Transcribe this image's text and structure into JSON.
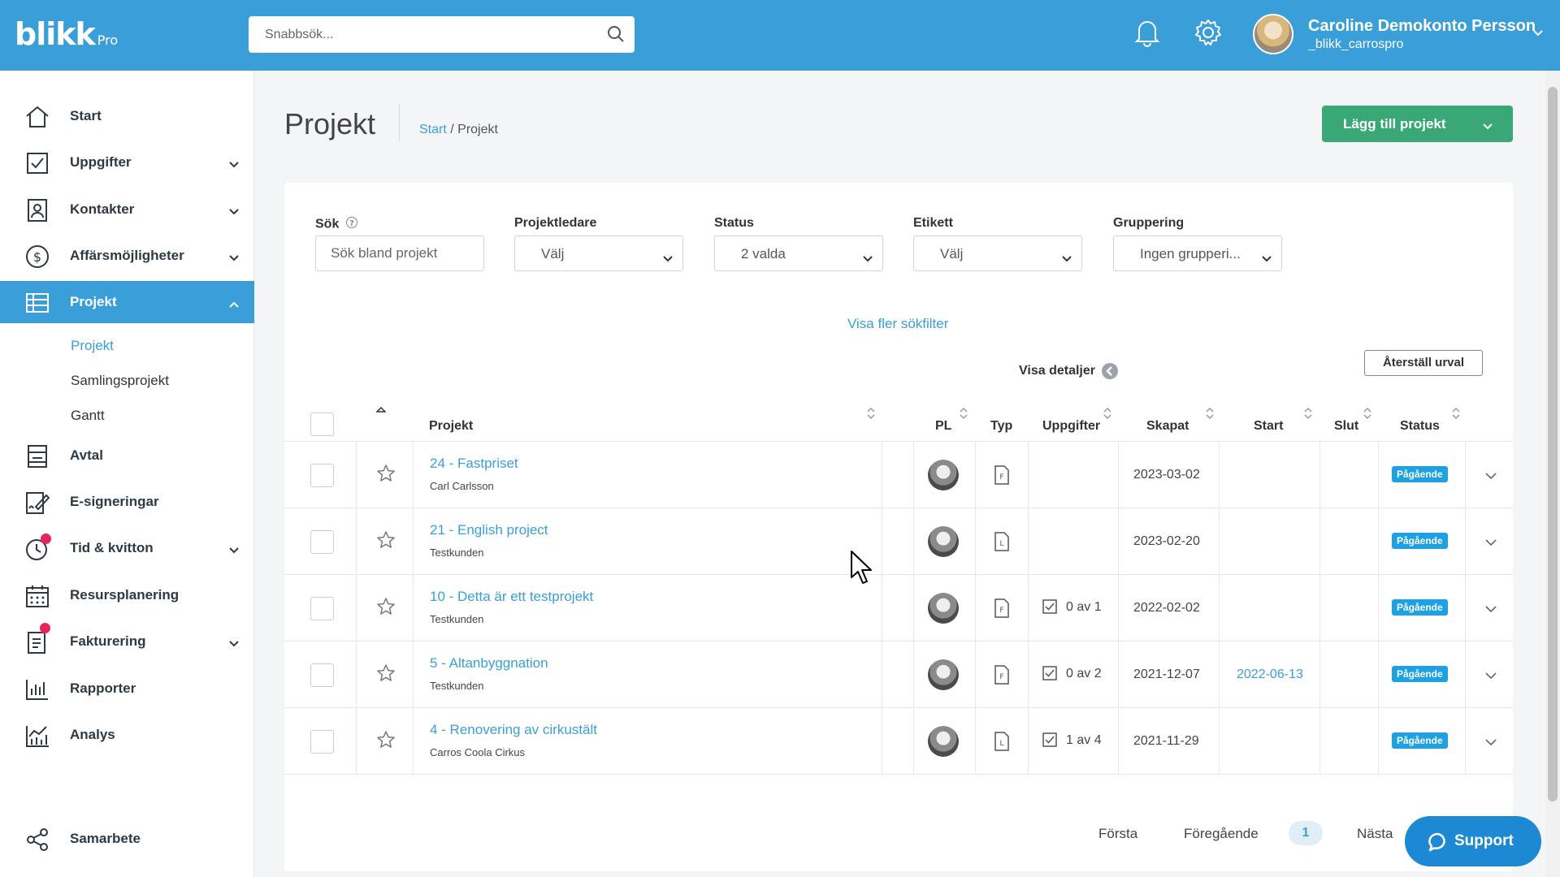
{
  "app": {
    "logo": "blikk",
    "logo_suffix": "Pro"
  },
  "header": {
    "search_placeholder": "Snabbsök...",
    "user_name": "Caroline Demokonto Persson",
    "user_handle": "_blikk_carrospro"
  },
  "sidebar": {
    "items": [
      {
        "label": "Start",
        "icon": "home-icon"
      },
      {
        "label": "Uppgifter",
        "icon": "checkbox-icon"
      },
      {
        "label": "Kontakter",
        "icon": "contact-card-icon"
      },
      {
        "label": "Affärsmöjligheter",
        "icon": "dollar-icon"
      },
      {
        "label": "Projekt",
        "icon": "table-icon"
      },
      {
        "label": "Avtal",
        "icon": "document-icon"
      },
      {
        "label": "E-signeringar",
        "icon": "sign-icon"
      },
      {
        "label": "Tid & kvitton",
        "icon": "clock-icon"
      },
      {
        "label": "Resursplanering",
        "icon": "calendar-icon"
      },
      {
        "label": "Fakturering",
        "icon": "invoice-icon"
      },
      {
        "label": "Rapporter",
        "icon": "bar-chart-icon"
      },
      {
        "label": "Analys",
        "icon": "analytics-icon"
      },
      {
        "label": "Samarbete",
        "icon": "share-icon"
      }
    ],
    "sub_items": [
      "Projekt",
      "Samlingsprojekt",
      "Gantt"
    ]
  },
  "page": {
    "title": "Projekt",
    "breadcrumb_start": "Start",
    "breadcrumb_sep": " / ",
    "breadcrumb_current": "Projekt",
    "add_button": "Lägg till projekt"
  },
  "filters": {
    "search_label": "Sök",
    "search_placeholder": "Sök bland projekt",
    "pl_label": "Projektledare",
    "pl_value": "Välj",
    "status_label": "Status",
    "status_value": "2 valda",
    "tag_label": "Etikett",
    "tag_value": "Välj",
    "group_label": "Gruppering",
    "group_value": "Ingen grupperi...",
    "more_filters": "Visa fler sökfilter",
    "show_details": "Visa detaljer",
    "reset": "Återställ urval"
  },
  "table": {
    "columns": [
      "Projekt",
      "PL",
      "Typ",
      "Uppgifter",
      "Skapat",
      "Start",
      "Slut",
      "Status"
    ],
    "rows": [
      {
        "name": "24 - Fastpriset",
        "client": "Carl Carlsson",
        "type": "F",
        "tasks": "",
        "created": "2023-03-02",
        "start": "",
        "end": "",
        "status": "Pågående"
      },
      {
        "name": "21 - English project",
        "client": "Testkunden",
        "type": "L",
        "tasks": "",
        "created": "2023-02-20",
        "start": "",
        "end": "",
        "status": "Pågående"
      },
      {
        "name": "10 - Detta är ett testprojekt",
        "client": "Testkunden",
        "type": "F",
        "tasks": "0 av 1",
        "created": "2022-02-02",
        "start": "",
        "end": "",
        "status": "Pågående"
      },
      {
        "name": "5 - Altanbyggnation",
        "client": "Testkunden",
        "type": "F",
        "tasks": "0 av 2",
        "created": "2021-12-07",
        "start": "2022-06-13",
        "end": "",
        "status": "Pågående"
      },
      {
        "name": "4 - Renovering av cirkustält",
        "client": "Carros Coola Cirkus",
        "type": "L",
        "tasks": "1 av 4",
        "created": "2021-11-29",
        "start": "",
        "end": "",
        "status": "Pågående"
      }
    ]
  },
  "pagination": {
    "first": "Första",
    "prev": "Föregående",
    "current": "1",
    "next": "Nästa"
  },
  "support": {
    "label": "Support"
  },
  "colors": {
    "primary": "#3a9fd9",
    "success": "#3aa876",
    "badge": "#1da1e2",
    "notify": "#e8245c"
  }
}
